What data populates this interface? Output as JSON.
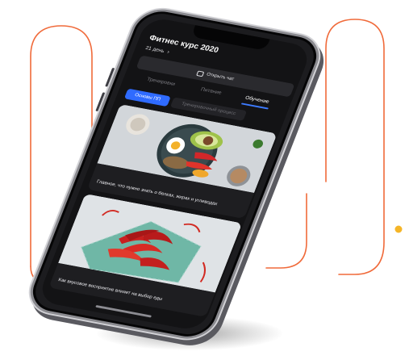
{
  "background": {
    "squiggle_color": "#f06a3a",
    "dot_color": "#f5b527"
  },
  "app": {
    "title": "Фитнес курс 2020",
    "day_label": "21 день",
    "day_chevron_icon": "chevron-right-icon"
  },
  "chat_button": {
    "label": "Открыть чат",
    "icon": "chat-icon"
  },
  "tabs": [
    {
      "label": "Тренировки",
      "active": false
    },
    {
      "label": "Питание",
      "active": false
    },
    {
      "label": "Обучение",
      "active": true
    }
  ],
  "filters": [
    {
      "label": "Основы ПП",
      "active": true
    },
    {
      "label": "Тренировочный процесс",
      "active": false
    }
  ],
  "cards": [
    {
      "caption": "Главное, что нужно знать о белках, жирах и углеводах",
      "image": "plate-with-avocado-egg-peppers"
    },
    {
      "caption": "Как вкусовое восприятие влияет на выбор еды",
      "image": "red-chili-peppers-on-plate"
    }
  ],
  "colors": {
    "accent": "#2f6bff",
    "screen_bg": "#131315",
    "card_bg": "#1e1e21"
  }
}
